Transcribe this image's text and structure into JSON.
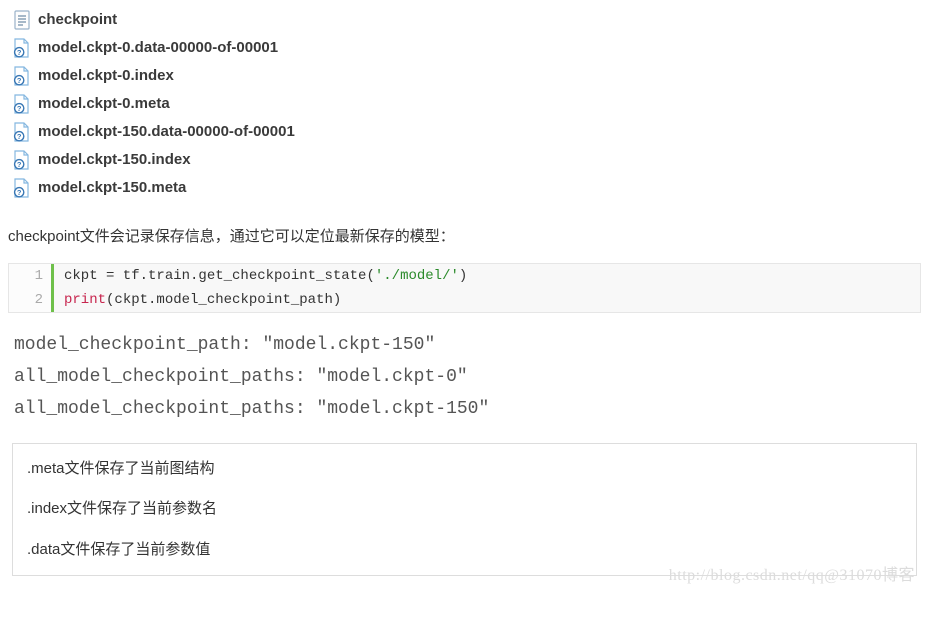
{
  "files": [
    {
      "name": "checkpoint",
      "icon": "text"
    },
    {
      "name": "model.ckpt-0.data-00000-of-00001",
      "icon": "unknown"
    },
    {
      "name": "model.ckpt-0.index",
      "icon": "unknown"
    },
    {
      "name": "model.ckpt-0.meta",
      "icon": "unknown"
    },
    {
      "name": "model.ckpt-150.data-00000-of-00001",
      "icon": "unknown"
    },
    {
      "name": "model.ckpt-150.index",
      "icon": "unknown"
    },
    {
      "name": "model.ckpt-150.meta",
      "icon": "unknown"
    }
  ],
  "paragraph": "checkpoint文件会记录保存信息，通过它可以定位最新保存的模型：",
  "code": {
    "lines": [
      {
        "n": "1",
        "html": "ckpt = tf.train.get_checkpoint_state(<span class=\"tok-str\">'./model/'</span>)"
      },
      {
        "n": "2",
        "html": "<span class=\"tok-print\">print</span>(ckpt.model_checkpoint_path)"
      }
    ]
  },
  "output_lines": [
    "model_checkpoint_path: \"model.ckpt-150\"",
    "all_model_checkpoint_paths: \"model.ckpt-0\"",
    "all_model_checkpoint_paths: \"model.ckpt-150\""
  ],
  "notes": [
    ".meta文件保存了当前图结构",
    ".index文件保存了当前参数名",
    ".data文件保存了当前参数值"
  ],
  "watermark": "http://blog.csdn.net/qq@31070博客"
}
